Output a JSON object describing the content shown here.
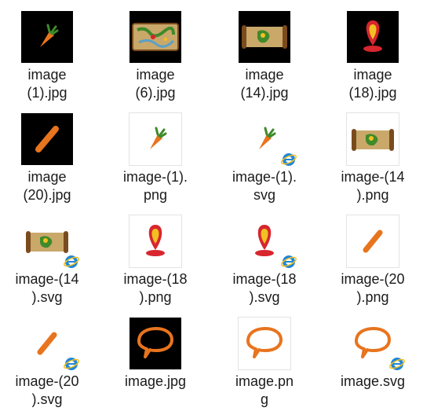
{
  "files": [
    {
      "label": "image\n(1).jpg",
      "icon": "carrot-icon",
      "bg": "dark",
      "badge": false
    },
    {
      "label": "image\n(6).jpg",
      "icon": "map-icon",
      "bg": "dark",
      "badge": false
    },
    {
      "label": "image\n(14).jpg",
      "icon": "scroll-map-icon",
      "bg": "dark",
      "badge": false
    },
    {
      "label": "image\n(18).jpg",
      "icon": "map-pin-icon",
      "bg": "dark",
      "badge": false
    },
    {
      "label": "image\n(20).jpg",
      "icon": "stick-icon",
      "bg": "dark",
      "badge": false
    },
    {
      "label": "image-(1).\npng",
      "icon": "carrot-icon",
      "bg": "light",
      "badge": false
    },
    {
      "label": "image-(1).\nsvg",
      "icon": "carrot-icon",
      "bg": "none",
      "badge": true
    },
    {
      "label": "image-(14\n).png",
      "icon": "scroll-map-icon",
      "bg": "light",
      "badge": false
    },
    {
      "label": "image-(14\n).svg",
      "icon": "scroll-map-icon",
      "bg": "none",
      "badge": true
    },
    {
      "label": "image-(18\n).png",
      "icon": "map-pin-icon",
      "bg": "light",
      "badge": false
    },
    {
      "label": "image-(18\n).svg",
      "icon": "map-pin-icon",
      "bg": "none",
      "badge": true
    },
    {
      "label": "image-(20\n).png",
      "icon": "stick-icon",
      "bg": "light",
      "badge": false
    },
    {
      "label": "image-(20\n).svg",
      "icon": "stick-icon",
      "bg": "none",
      "badge": true
    },
    {
      "label": "image.jpg",
      "icon": "speech-bubble-icon",
      "bg": "dark",
      "badge": false
    },
    {
      "label": "image.pn\ng",
      "icon": "speech-bubble-icon",
      "bg": "light",
      "badge": false
    },
    {
      "label": "image.svg",
      "icon": "speech-bubble-icon",
      "bg": "none",
      "badge": true
    }
  ],
  "colors": {
    "orange": "#e8741e",
    "carrot_green": "#3f8a2a",
    "pin_red": "#d7262e",
    "pin_yellow": "#f2c021",
    "map_tan": "#c9a86a",
    "ie_blue": "#1f86d6"
  }
}
